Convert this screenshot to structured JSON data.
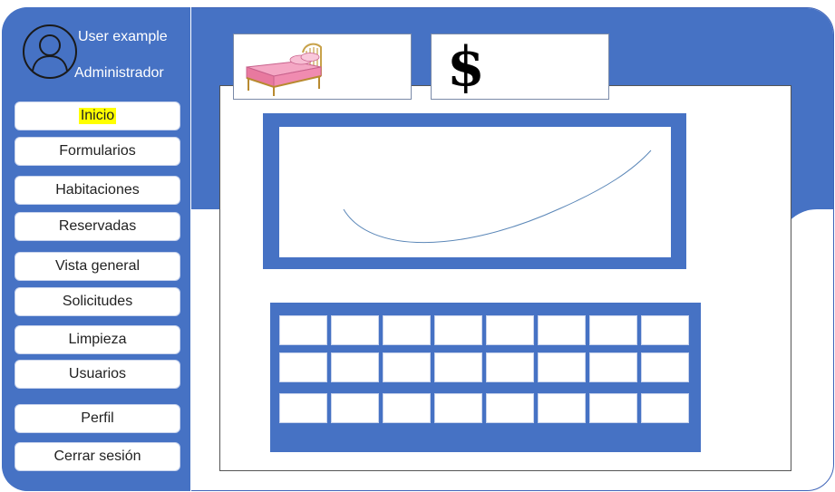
{
  "user": {
    "name": "User example",
    "role": "Administrador"
  },
  "sidebar": {
    "items": [
      {
        "label": "Inicio",
        "active": true
      },
      {
        "label": "Formularios"
      },
      {
        "label": "Habitaciones"
      },
      {
        "label": "Reservadas"
      },
      {
        "label": "Vista general"
      },
      {
        "label": "Solicitudes"
      },
      {
        "label": "Limpieza"
      },
      {
        "label": "Usuarios"
      },
      {
        "label": "Perfil"
      },
      {
        "label": "Cerrar sesión"
      }
    ]
  },
  "cards": {
    "rooms_icon": "bed-icon",
    "money_icon": "dollar-icon",
    "money_symbol": "$"
  },
  "grid": {
    "rows": 3,
    "columns": 8
  },
  "colors": {
    "primary": "#4672c4",
    "highlight": "#ffff00",
    "panel": "#ffffff"
  }
}
